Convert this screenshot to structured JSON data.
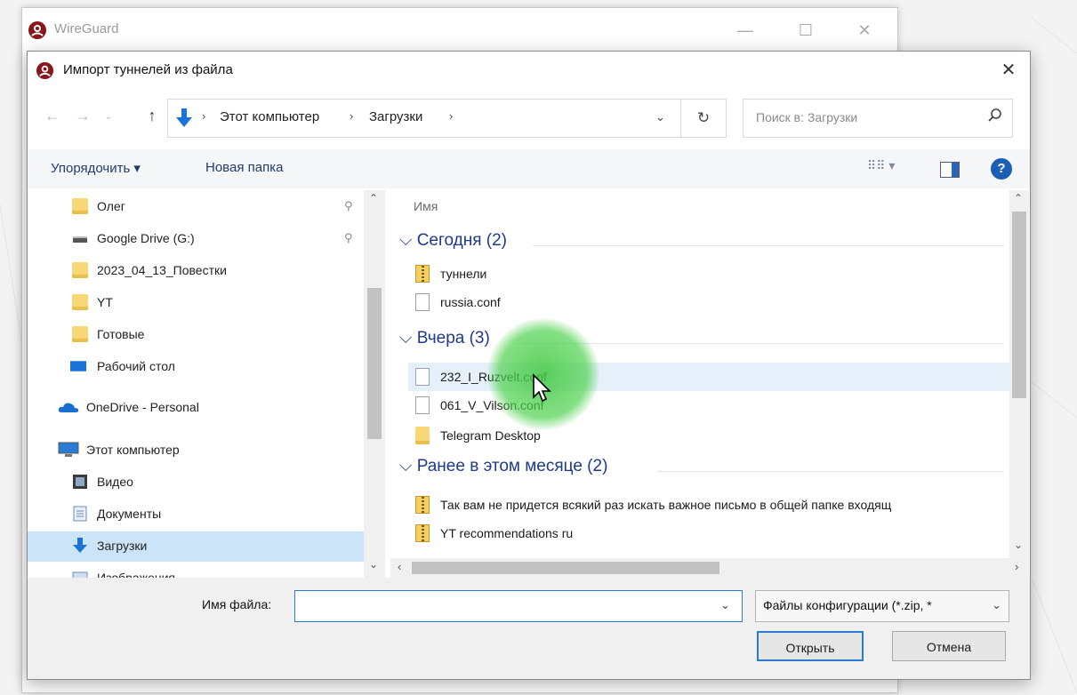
{
  "colors": {
    "accent": "#2a7bd4",
    "selection": "#cce4f7",
    "group_heading": "#1e3a8a",
    "click_glow": "#4bc84b"
  },
  "wireguard_window": {
    "title": "WireGuard",
    "controls": {
      "minimize": "—",
      "maximize": "☐",
      "close": "✕"
    }
  },
  "dialog": {
    "title": "Импорт туннелей из файла",
    "close": "✕",
    "nav": {
      "back": "←",
      "forward": "→",
      "recent": "⌄",
      "up": "↑"
    },
    "address": {
      "crumbs": [
        "Этот компьютер",
        "Загрузки"
      ],
      "separator": "›",
      "dropdown": "⌄",
      "refresh": "↻"
    },
    "search": {
      "placeholder": "Поиск в: Загрузки"
    },
    "toolbar": {
      "organize": "Упорядочить ▾",
      "new_folder": "Новая папка",
      "view": "⠿⠿ ▾",
      "help": "?"
    },
    "nav_pane": {
      "items": [
        {
          "label": "Олег",
          "icon": "folder-icon",
          "pinned": true
        },
        {
          "label": "Google Drive (G:)",
          "icon": "drive-icon",
          "pinned": true
        },
        {
          "label": "2023_04_13_Повестки",
          "icon": "folder-icon"
        },
        {
          "label": "YT",
          "icon": "folder-icon"
        },
        {
          "label": "Готовые",
          "icon": "folder-icon"
        },
        {
          "label": "Рабочий стол",
          "icon": "desktop-icon"
        },
        {
          "label": "OneDrive - Personal",
          "icon": "cloud-icon"
        },
        {
          "label": "Этот компьютер",
          "icon": "computer-icon"
        },
        {
          "label": "Видео",
          "icon": "video-icon"
        },
        {
          "label": "Документы",
          "icon": "documents-icon"
        },
        {
          "label": "Загрузки",
          "icon": "downloads-icon",
          "selected": true
        },
        {
          "label": "Изображения",
          "icon": "pictures-icon"
        }
      ],
      "pin_glyph": "⚲",
      "scroll_up": "⌃",
      "scroll_down": "⌄"
    },
    "file_list": {
      "column_header": "Имя",
      "group_chevron": "⌵",
      "groups": [
        {
          "heading": "Сегодня (2)",
          "files": [
            {
              "name": "туннели",
              "icon": "zip-icon"
            },
            {
              "name": "russia.conf",
              "icon": "document-icon"
            }
          ]
        },
        {
          "heading": "Вчера (3)",
          "files": [
            {
              "name": "232_I_Ruzvelt.conf",
              "icon": "document-icon",
              "hovered": true
            },
            {
              "name": "061_V_Vilson.conf",
              "icon": "document-icon"
            },
            {
              "name": "Telegram Desktop",
              "icon": "folder-icon"
            }
          ]
        },
        {
          "heading": "Ранее в этом месяце (2)",
          "files": [
            {
              "name": "Так вам не придется всякий раз искать важное письмо в общей папке входящ",
              "icon": "zip-icon"
            },
            {
              "name": "YT recommendations ru",
              "icon": "zip-icon"
            }
          ]
        }
      ],
      "scroll_up": "⌃",
      "scroll_down": "⌄",
      "scroll_left": "‹",
      "scroll_right": "›"
    },
    "bottom": {
      "filename_label": "Имя файла:",
      "filename_value": "",
      "filename_dropdown": "⌄",
      "filter_value": "Файлы конфигурации (*.zip, *",
      "filter_dropdown": "⌄",
      "open_button": "Открыть",
      "cancel_button": "Отмена"
    }
  }
}
